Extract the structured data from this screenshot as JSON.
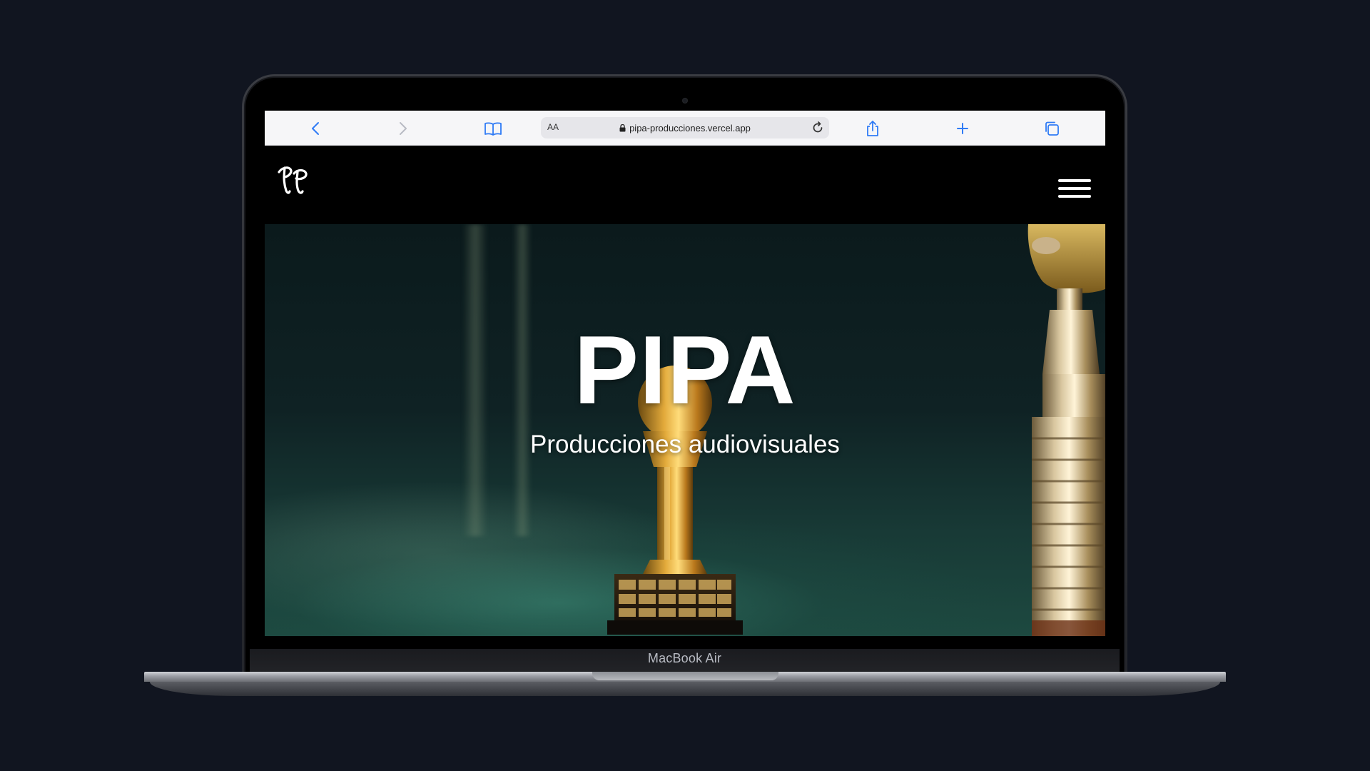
{
  "device": {
    "label": "MacBook Air"
  },
  "browser": {
    "text_size_label": "AA",
    "url": "pipa-producciones.vercel.app",
    "icons": {
      "back": "chevron-left-icon",
      "forward": "chevron-right-icon",
      "bookmarks": "book-icon",
      "lock": "lock-icon",
      "reload": "reload-icon",
      "share": "share-icon",
      "new_tab": "plus-icon",
      "tabs": "tabs-icon"
    },
    "accent_color": "#2F7BF5"
  },
  "site": {
    "logo_icon": "pp-monogram-logo",
    "menu_icon": "hamburger-menu-icon",
    "hero": {
      "title": "PIPA",
      "subtitle": "Producciones audiovisuales"
    }
  },
  "colors": {
    "page_background": "#111520",
    "site_header": "#000000",
    "hero_text": "#FFFFFF"
  }
}
